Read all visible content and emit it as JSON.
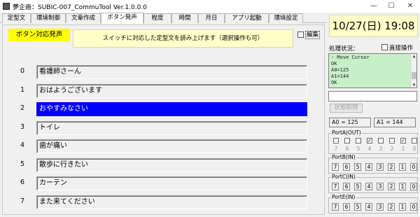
{
  "window": {
    "title": "夢企画：SUBIC-007_CommuTool Ver.1.0.0.0",
    "minimize": "—",
    "maximize": "☐",
    "close": "✕"
  },
  "tabs": [
    {
      "label": "定型文"
    },
    {
      "label": "環境制御"
    },
    {
      "label": "文章作成"
    },
    {
      "label": "ボタン発声"
    },
    {
      "label": "程度"
    },
    {
      "label": "時間"
    },
    {
      "label": "月日"
    },
    {
      "label": "アプリ起動"
    },
    {
      "label": "環境設定"
    }
  ],
  "active_tab": "ボタン発声",
  "main": {
    "mode_label": "ボタン対応発声",
    "instruction": "スイッチに対応した定型文を読み上げます（選択操作も可）",
    "edit_label": "編集"
  },
  "phrases": [
    {
      "num": "0",
      "text": "看護師さーん"
    },
    {
      "num": "1",
      "text": "おはようございます"
    },
    {
      "num": "2",
      "text": "おやすみなさい"
    },
    {
      "num": "3",
      "text": "トイレ"
    },
    {
      "num": "4",
      "text": "歯が痛い"
    },
    {
      "num": "5",
      "text": "散歩に行きたい"
    },
    {
      "num": "6",
      "text": "カーテン"
    },
    {
      "num": "7",
      "text": "また来てください"
    }
  ],
  "selected_phrase": "2",
  "right": {
    "datetime": "10/27(日) 19:08",
    "status_label": "処理状況：",
    "direct_label": "直接操作",
    "log_lines": [
      "- Move Cursor",
      "OK",
      "A0=125",
      "A1=144",
      "OK"
    ],
    "get_status": "状態取得",
    "a0": "A0 = 125",
    "a1": "A1 = 144"
  },
  "ports": {
    "port_a": {
      "title": "PortA(OUT)",
      "bits": [
        "7",
        "6",
        "5",
        "4",
        "3",
        "2",
        "1",
        "0"
      ],
      "checked": [
        false,
        false,
        false,
        true,
        false,
        false,
        true,
        false
      ]
    },
    "port_b": {
      "title": "PortB(IN)",
      "bits": [
        "7",
        "6",
        "5",
        "4",
        "3",
        "2",
        "1",
        "0"
      ]
    },
    "port_c": {
      "title": "PortC(IN)",
      "bits": [
        "7",
        "6",
        "5",
        "4",
        "3",
        "2",
        "1",
        "0"
      ]
    },
    "port_e": {
      "title": "PortE(IN)",
      "bits": [
        "7",
        "6",
        "5",
        "4",
        "3",
        "2",
        "1",
        "0"
      ]
    }
  },
  "colors": {
    "mode_label_bg": "#ffff00",
    "info_bg": "#ffffc8",
    "selected_bg": "#0000ff",
    "log_bg": "#c8f0c8"
  }
}
